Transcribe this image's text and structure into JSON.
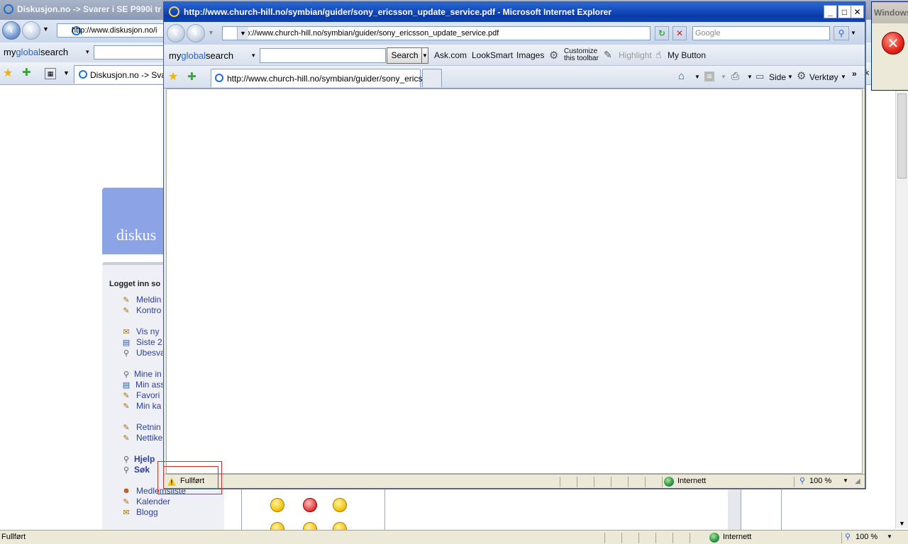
{
  "background_window": {
    "title": "Diskusjon.no -> Svarer i SE P990i tr",
    "address": "http://www.diskusjon.no/i",
    "toolbar_brand_my": "my",
    "toolbar_brand_global": "global",
    "toolbar_brand_search": "search",
    "tab_label": "Diskusjon.no -> Svar",
    "banner_text": "diskus",
    "logged_in_label": "Logget inn so",
    "sidebar_links": [
      "Meldin",
      "Kontro",
      "Vis ny",
      "Siste 2",
      "Ubesva",
      "Mine in",
      "Min ass",
      "Favori",
      "Min ka",
      "Retnin",
      "Nettike",
      "Hjelp",
      "Søk",
      "Medlemsliste",
      "Kalender",
      "Blogg"
    ],
    "status_left": "Fullført",
    "status_zone": "Internett",
    "status_zoom": "100 %",
    "tab_edge_text": "rk"
  },
  "dialog": {
    "title": "Windows"
  },
  "window": {
    "title": "http://www.church-hill.no/symbian/guider/sony_ericsson_update_service.pdf - Microsoft Internet Explorer",
    "address": "http://www.church-hill.no/symbian/guider/sony_ericsson_update_service.pdf",
    "search_placeholder": "Google",
    "tab_label": "http://www.church-hill.no/symbian/guider/sony_erics...",
    "status_text": "Fullført",
    "status_zone": "Internett",
    "status_zoom": "100 %"
  },
  "toolbar": {
    "brand_my": "my",
    "brand_global": "global",
    "brand_search": "search",
    "search_button": "Search",
    "links": [
      "Ask.com",
      "LookSmart",
      "Images"
    ],
    "customize_line1": "Customize",
    "customize_line2": "this toolbar",
    "highlight": "Highlight",
    "my_button": "My Button"
  },
  "commands": {
    "page": "Side",
    "tools": "Verktøy",
    "more": "»"
  },
  "icons": {
    "back": "back-arrow-icon",
    "forward": "forward-arrow-icon",
    "favorites": "star-icon",
    "add_favorite": "add-favorite-icon",
    "home": "home-icon",
    "feeds": "rss-icon",
    "print": "printer-icon",
    "error": "error-x-icon",
    "warning": "warning-icon",
    "zone": "globe-icon",
    "zoom": "magnifier-icon"
  },
  "colors": {
    "title_bar": "#0a3aa8",
    "highlight_box": "#d52b2b",
    "link": "#2e3f9a",
    "toolbar_brand_blue": "#2a62c9"
  }
}
